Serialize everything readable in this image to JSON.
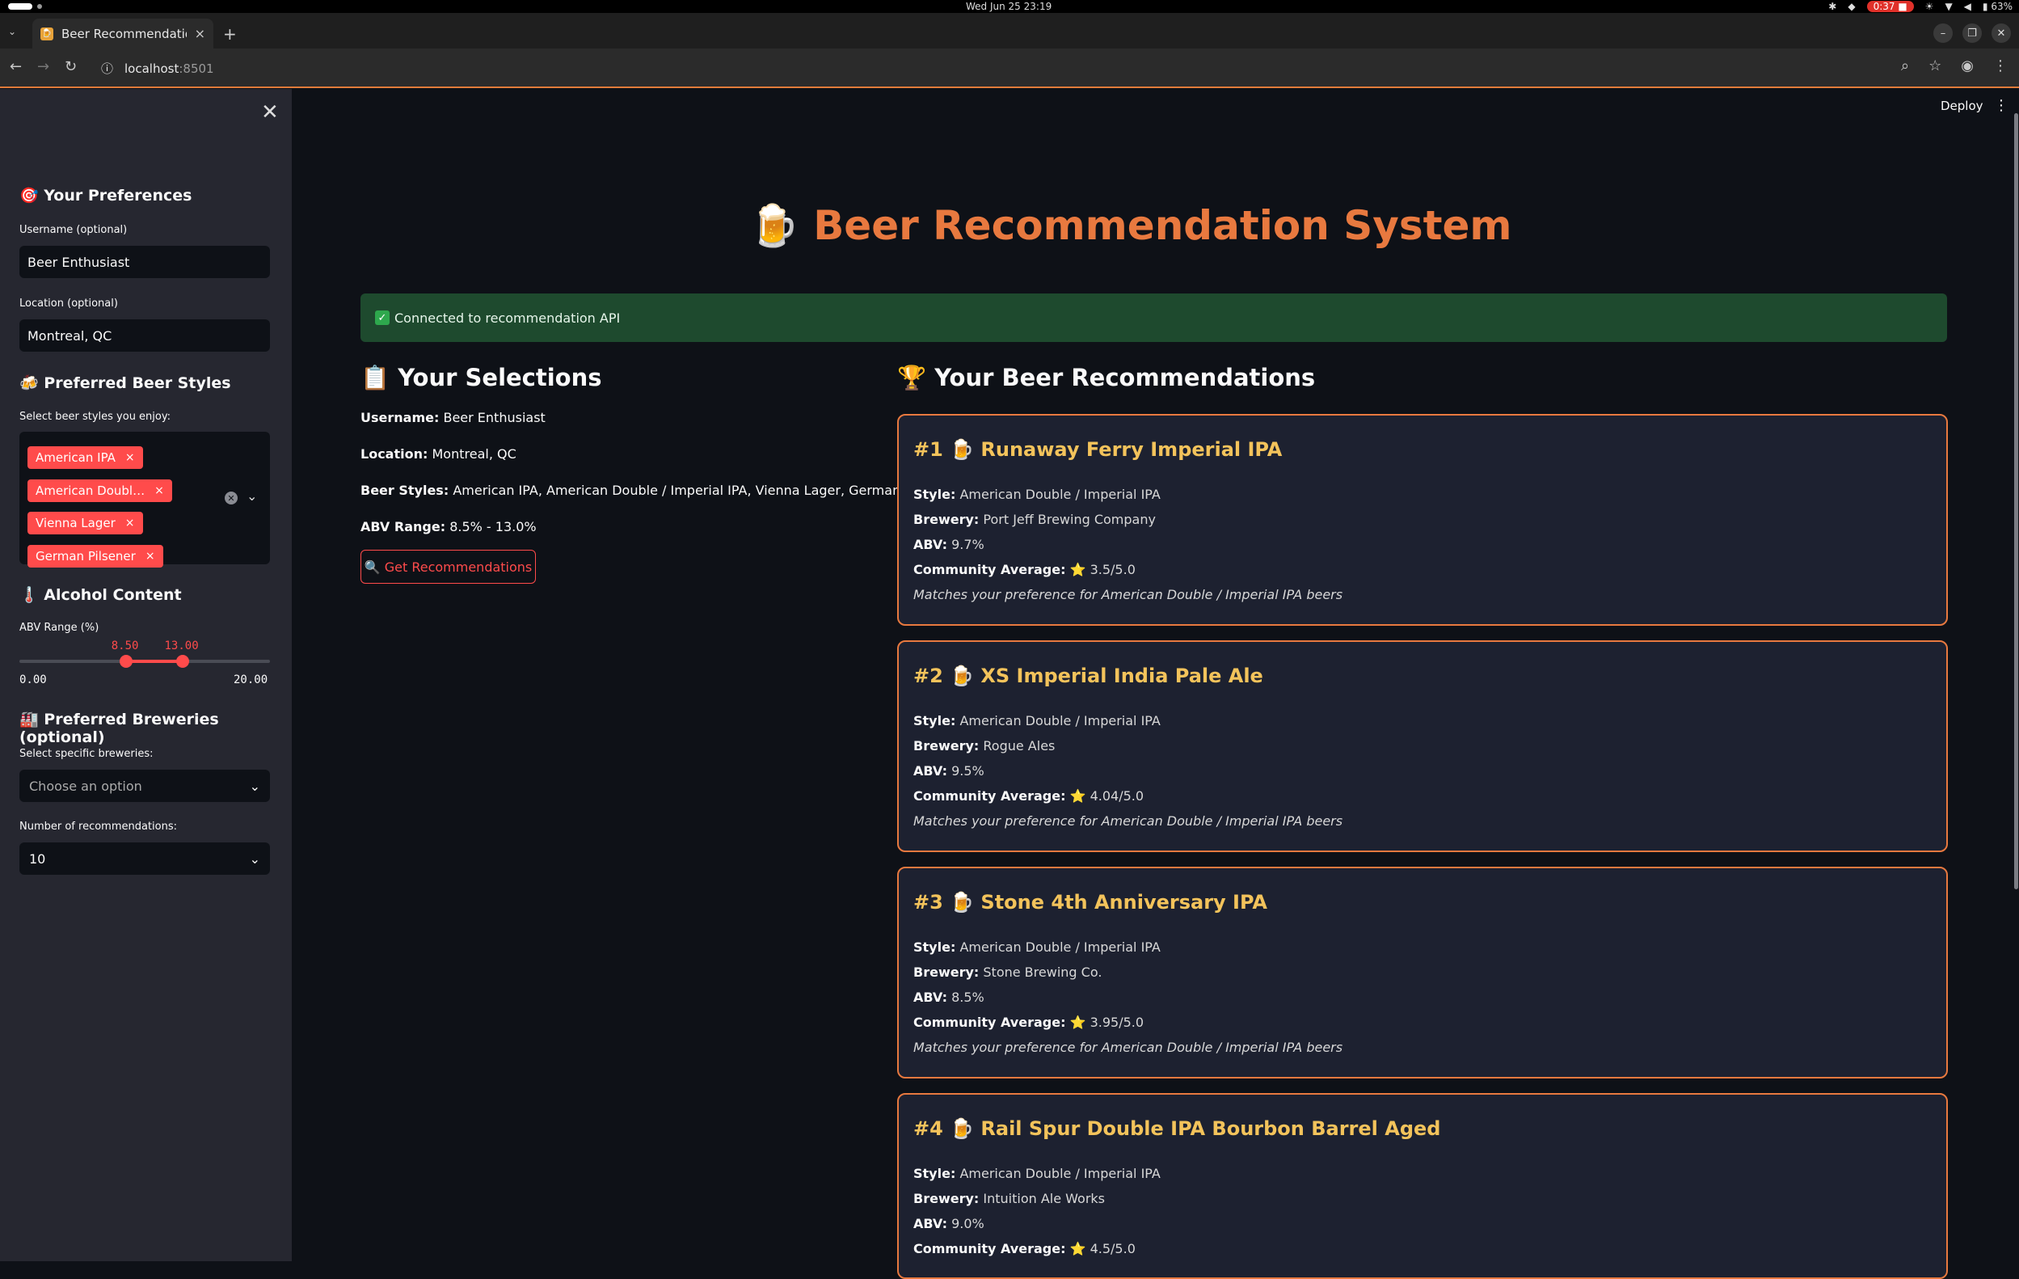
{
  "os": {
    "clock": "Wed Jun 25  23:19",
    "rec": "0:37",
    "battery": "63%"
  },
  "browser": {
    "tab_title": "Beer Recommendation S",
    "url_host": "localhost",
    "url_port": ":8501"
  },
  "sidebar": {
    "close": "✕",
    "prefs_heading": "🎯 Your Preferences",
    "username_label": "Username (optional)",
    "username_value": "Beer Enthusiast",
    "location_label": "Location (optional)",
    "location_value": "Montreal, QC",
    "styles_heading": "🍻 Preferred Beer Styles",
    "styles_label": "Select beer styles you enjoy:",
    "styles_chips": [
      "American IPA",
      "American Doubl…",
      "Vienna Lager",
      "German Pilsener"
    ],
    "alcohol_heading": "🌡️ Alcohol Content",
    "abv_label": "ABV Range (%)",
    "abv_low": "8.50",
    "abv_high": "13.00",
    "abv_min": "0.00",
    "abv_max": "20.00",
    "abv_low_fraction": 0.425,
    "abv_high_fraction": 0.65,
    "breweries_heading": "🏭 Preferred Breweries (optional)",
    "breweries_label": "Select specific breweries:",
    "breweries_placeholder": "Choose an option",
    "num_label": "Number of recommendations:",
    "num_value": "10"
  },
  "main": {
    "deploy": "Deploy",
    "title_emoji": "🍺",
    "title": "Beer Recommendation System",
    "alert": "Connected to recommendation API",
    "selections_heading": "📋 Your Selections",
    "sel_username_key": "Username:",
    "sel_username_val": "Beer Enthusiast",
    "sel_location_key": "Location:",
    "sel_location_val": "Montreal, QC",
    "sel_styles_key": "Beer Styles:",
    "sel_styles_val": "American IPA, American Double / Imperial IPA, Vienna Lager, German Pilsener",
    "sel_abv_key": "ABV Range:",
    "sel_abv_val": "8.5% - 13.0%",
    "button": "🔍 Get Recommendations",
    "recs_heading": "🏆 Your Beer Recommendations"
  },
  "labels": {
    "style": "Style:",
    "brewery": "Brewery:",
    "abv": "ABV:",
    "community": "Community Average:"
  },
  "recommendations": [
    {
      "title": "#1 🍺 Runaway Ferry Imperial IPA",
      "style": "American Double / Imperial IPA",
      "brewery": "Port Jeff Brewing Company",
      "abv": "9.7%",
      "rating": "⭐ 3.5/5.0",
      "note": "Matches your preference for American Double / Imperial IPA beers"
    },
    {
      "title": "#2 🍺 XS Imperial India Pale Ale",
      "style": "American Double / Imperial IPA",
      "brewery": "Rogue Ales",
      "abv": "9.5%",
      "rating": "⭐ 4.04/5.0",
      "note": "Matches your preference for American Double / Imperial IPA beers"
    },
    {
      "title": "#3 🍺 Stone 4th Anniversary IPA",
      "style": "American Double / Imperial IPA",
      "brewery": "Stone Brewing Co.",
      "abv": "8.5%",
      "rating": "⭐ 3.95/5.0",
      "note": "Matches your preference for American Double / Imperial IPA beers"
    },
    {
      "title": "#4 🍺 Rail Spur Double IPA Bourbon Barrel Aged",
      "style": "American Double / Imperial IPA",
      "brewery": "Intuition Ale Works",
      "abv": "9.0%",
      "rating": "⭐ 4.5/5.0",
      "note": ""
    }
  ]
}
